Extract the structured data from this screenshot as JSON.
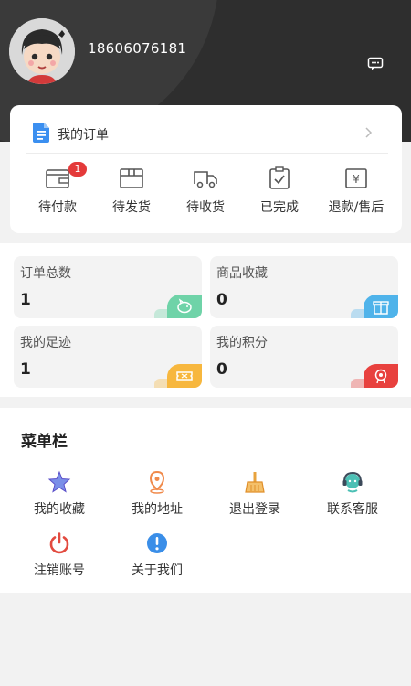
{
  "profile": {
    "phone": "18606076181"
  },
  "orders": {
    "title": "我的订单",
    "items": [
      {
        "label": "待付款",
        "badge": "1"
      },
      {
        "label": "待发货"
      },
      {
        "label": "待收货"
      },
      {
        "label": "已完成"
      },
      {
        "label": "退款/售后"
      }
    ]
  },
  "stats": [
    {
      "label": "订单总数",
      "value": "1",
      "color": "#6fd3a8",
      "icon": "piggy-bank-icon"
    },
    {
      "label": "商品收藏",
      "value": "0",
      "color": "#4fb3ea",
      "icon": "gift-icon"
    },
    {
      "label": "我的足迹",
      "value": "1",
      "color": "#f7b73e",
      "icon": "ticket-icon"
    },
    {
      "label": "我的积分",
      "value": "0",
      "color": "#e8413e",
      "icon": "medal-icon"
    }
  ],
  "menu": {
    "title": "菜单栏",
    "items": [
      {
        "label": "我的收藏",
        "icon": "star-icon"
      },
      {
        "label": "我的地址",
        "icon": "location-pin-icon"
      },
      {
        "label": "退出登录",
        "icon": "broom-icon"
      },
      {
        "label": "联系客服",
        "icon": "headset-icon"
      },
      {
        "label": "注销账号",
        "icon": "power-icon"
      },
      {
        "label": "关于我们",
        "icon": "info-icon"
      }
    ]
  }
}
